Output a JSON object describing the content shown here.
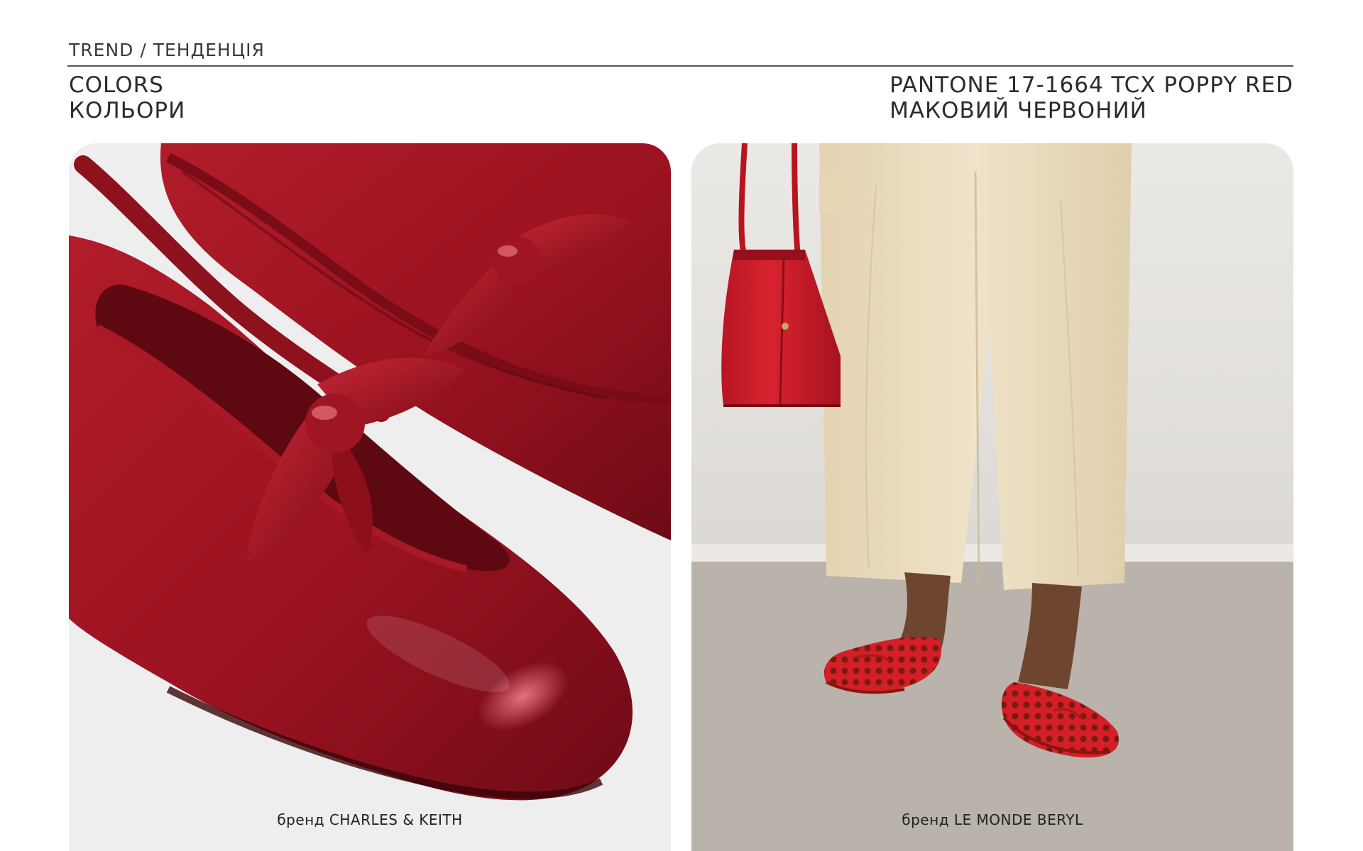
{
  "header": {
    "breadcrumb": "TREND / ТЕНДЕНЦІЯ",
    "section_title_en": "COLORS",
    "section_title_ua": "КОЛЬОРИ",
    "pantone_code": "PANTONE 17-1664 TCX POPPY RED",
    "pantone_name_ua": "МАКОВИЙ ЧЕРВОНИЙ"
  },
  "cards": [
    {
      "image": "red-patent-slingback-flats-with-bow-photo",
      "caption": "бренд CHARLES & KEITH"
    },
    {
      "image": "red-woven-ballet-flats-and-red-bag-photo",
      "caption": "бренд LE MONDE BERYL"
    }
  ],
  "colors": {
    "poppy_red": "#c8202e",
    "wine_red": "#9e1422",
    "trousers_beige": "#e9dcc0",
    "floor_grey": "#bdb7b0"
  }
}
